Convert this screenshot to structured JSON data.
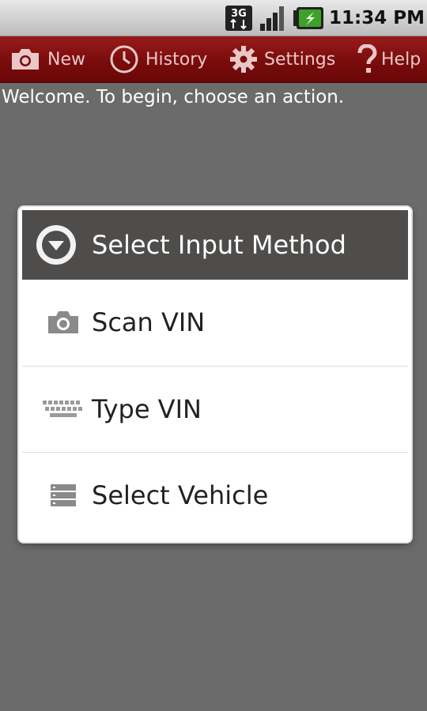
{
  "status_bar": {
    "network_label": "3G",
    "time": "11:34 PM",
    "icons": [
      "network-3g-icon",
      "signal-strength-icon",
      "battery-charging-icon"
    ]
  },
  "action_bar": {
    "items": [
      {
        "label": "New",
        "icon": "camera-icon"
      },
      {
        "label": "History",
        "icon": "clock-icon"
      },
      {
        "label": "Settings",
        "icon": "gear-icon"
      },
      {
        "label": "Help",
        "icon": "question-icon"
      }
    ],
    "colors": {
      "background": "#7a0c0c",
      "text": "#e9c7c7"
    }
  },
  "main": {
    "welcome_text": "Welcome. To begin, choose an action."
  },
  "dialog": {
    "title": "Select Input Method",
    "title_icon": "dropdown-circle-icon",
    "options": [
      {
        "label": "Scan VIN",
        "icon": "camera-icon"
      },
      {
        "label": "Type VIN",
        "icon": "keyboard-icon"
      },
      {
        "label": "Select Vehicle",
        "icon": "list-icon"
      }
    ]
  },
  "colors": {
    "background": "#6b6b6b",
    "dialog_header": "#4e4d4b",
    "battery_green": "#3ea12b"
  }
}
